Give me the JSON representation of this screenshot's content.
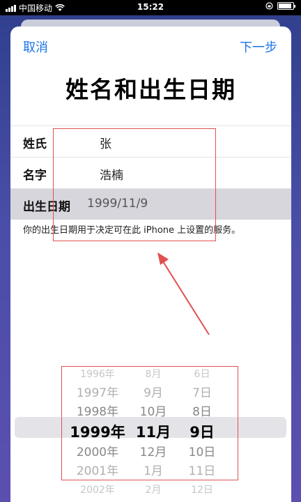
{
  "status_bar": {
    "carrier": "中国移动",
    "time": "15:22"
  },
  "nav": {
    "cancel": "取消",
    "next": "下一步"
  },
  "title": "姓名和出生日期",
  "form": {
    "last_name_label": "姓氏",
    "last_name_value": "张",
    "first_name_label": "名字",
    "first_name_value": "浩楠",
    "birthday_label": "出生日期",
    "birthday_value": "1999/11/9",
    "footnote": "你的出生日期用于决定可在此 iPhone 上设置的服务。"
  },
  "picker": {
    "years": [
      "1996年",
      "1997年",
      "1998年",
      "1999年",
      "2000年",
      "2001年",
      "2002年"
    ],
    "months": [
      "8月",
      "9月",
      "10月",
      "11月",
      "12月",
      "1月",
      "2月"
    ],
    "days": [
      "6日",
      "7日",
      "8日",
      "9日",
      "10日",
      "11日",
      "12日"
    ],
    "selected_index": 3
  },
  "colors": {
    "accent": "#1a73e8",
    "annotation": "#e05050"
  }
}
